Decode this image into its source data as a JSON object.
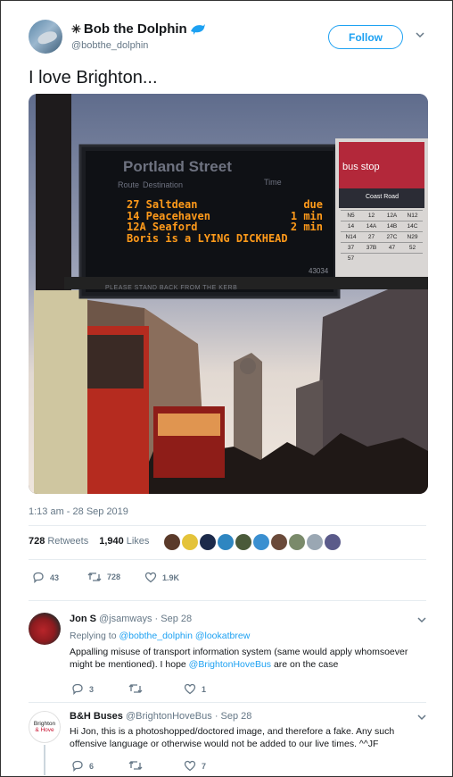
{
  "author": {
    "display_name": "Bob the Dolphin",
    "handle": "@bobthe_dolphin",
    "follow_label": "Follow"
  },
  "tweet": {
    "text": "I love Brighton...",
    "timestamp": "1:13 am - 28 Sep 2019",
    "retweets_count": "728",
    "retweets_label": "Retweets",
    "likes_count": "1,940",
    "likes_label": "Likes",
    "action_replies": "43",
    "action_retweets": "728",
    "action_likes": "1.9K"
  },
  "photo": {
    "sign_stop": "Portland Street",
    "sign_col_route": "Route",
    "sign_col_destination": "Destination",
    "sign_col_time": "Time",
    "rows": [
      {
        "text": "27 Saltdean",
        "time": "due"
      },
      {
        "text": "14 Peacehaven",
        "time": "1 min"
      },
      {
        "text": "12A Seaford",
        "time": "2 min"
      },
      {
        "text": "Boris is a LYING DICKHEAD",
        "time": ""
      }
    ],
    "sign_id": "43034",
    "sign_footer": "PLEASE STAND BACK FROM THE KERB",
    "busstop_label": "bus stop",
    "busstop_road": "Coast Road",
    "busstop_routes": [
      [
        "N5",
        "12",
        "12A",
        "N12"
      ],
      [
        "14",
        "14A",
        "14B",
        "14C"
      ],
      [
        "N14",
        "27",
        "27C",
        "N29"
      ],
      [
        "37",
        "37B",
        "47",
        "52"
      ],
      [
        "57",
        "",
        "",
        ""
      ]
    ]
  },
  "replies": [
    {
      "name": "Jon S",
      "handle": "@jsamways",
      "date": "· Sep 28",
      "replying_prefix": "Replying to",
      "replying_to": "@bobthe_dolphin @lookatbrew",
      "text_before": "Appalling misuse of transport information system (same would apply whomsoever might be mentioned). I hope ",
      "text_link": "@BrightonHoveBus",
      "text_after": " are on the case",
      "retweets": "",
      "replies": "3",
      "likes": "1"
    },
    {
      "name": "B&H Buses",
      "handle": "@BrightonHoveBus",
      "date": "· Sep 28",
      "avatar_text_1": "Brighton",
      "avatar_text_2": "& Hove",
      "text": "Hi Jon, this is a photoshopped/doctored image, and therefore a fake. Any such offensive language or otherwise would not be added to our live times. ^^JF",
      "replies": "6",
      "retweets": "",
      "likes": "7"
    }
  ],
  "colors": {
    "accent": "#1da1f2",
    "muted": "#657786",
    "led": "#ff9a1a"
  }
}
